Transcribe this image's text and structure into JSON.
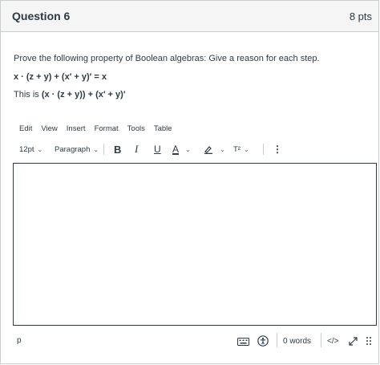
{
  "question": {
    "title": "Question 6",
    "points": "8 pts",
    "prompt": "Prove the following property of Boolean algebras: Give a reason for each step.",
    "expression": "x · (z + y) + (x′ + y)′ = x",
    "this_is_label": "This is ",
    "this_is_expr": "(x · (z + y)) + (x′ + y)′"
  },
  "editor": {
    "menu": [
      "Edit",
      "View",
      "Insert",
      "Format",
      "Tools",
      "Table"
    ],
    "font_size": "12pt",
    "block_format": "Paragraph",
    "bold": "B",
    "italic": "I",
    "underline": "U",
    "text_color": "A",
    "superscript": "T²",
    "more": "⋮",
    "status_path": "p",
    "word_count": "0 words",
    "html_toggle": "</>"
  },
  "icons": {
    "chevron": "chevron-down-icon",
    "highlight": "highlight-pen-icon",
    "keyboard": "keyboard-icon",
    "accessibility": "accessibility-icon",
    "fullscreen": "fullscreen-icon",
    "resize": "resize-handle-icon"
  }
}
